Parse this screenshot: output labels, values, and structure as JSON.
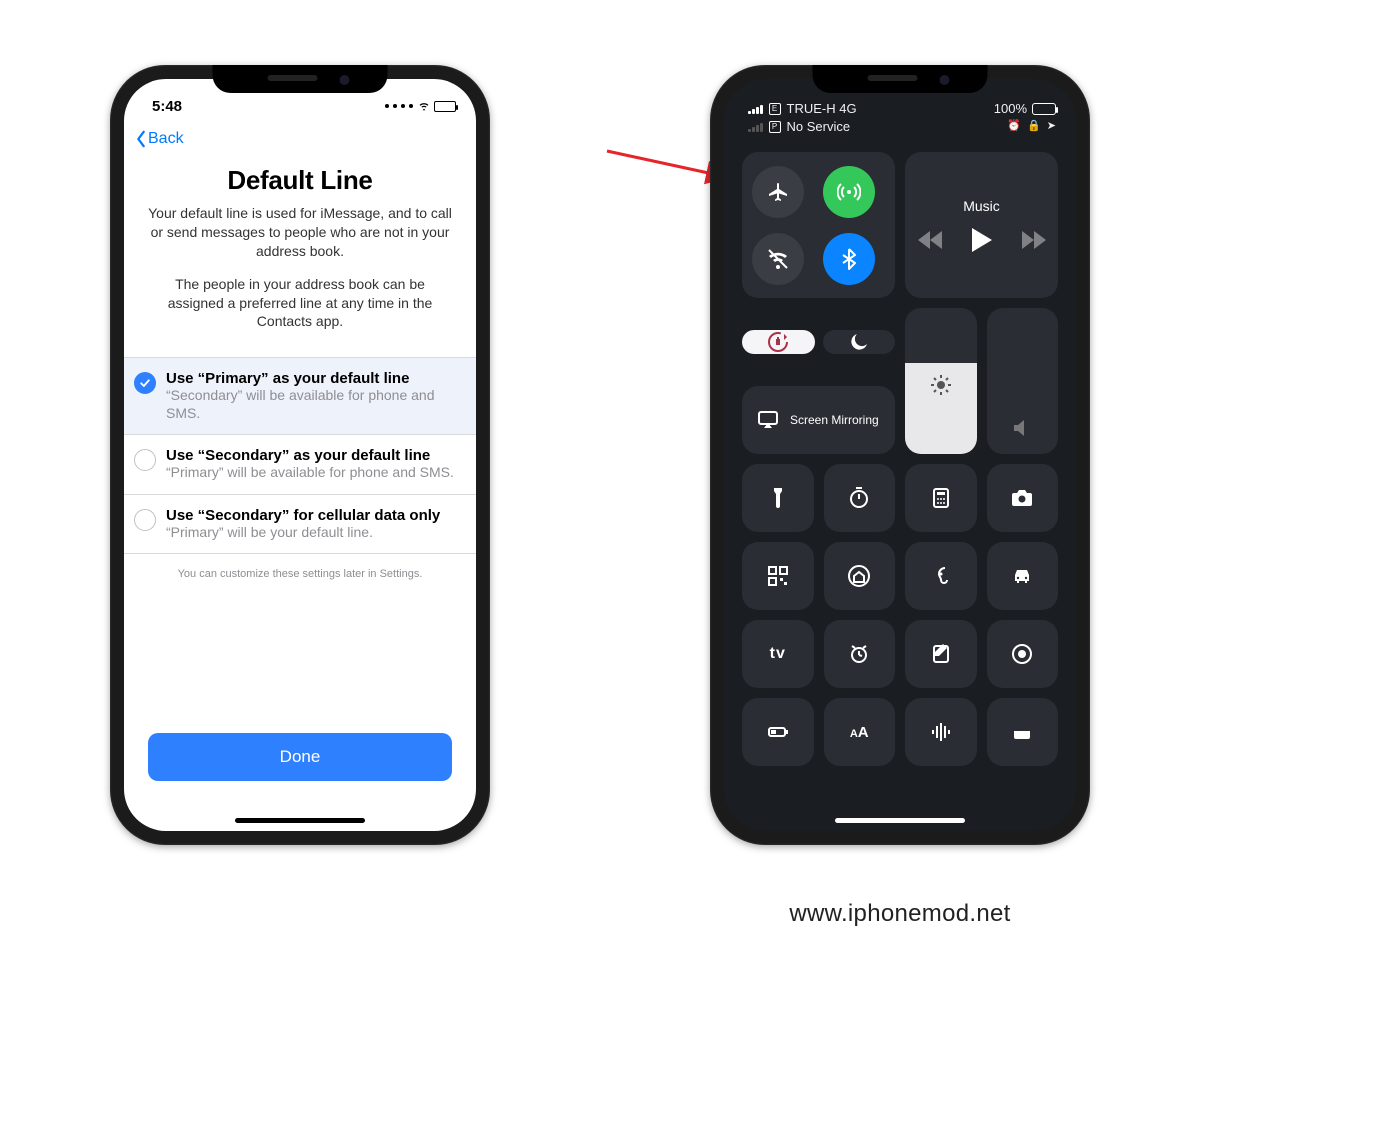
{
  "phone1": {
    "time": "5:48",
    "back_label": "Back",
    "title": "Default Line",
    "intro1": "Your default line is used for iMessage, and to call or send messages to people who are not in your address book.",
    "intro2": "The people in your address book can be assigned a preferred line at any time in the Contacts app.",
    "options": [
      {
        "title": "Use “Primary” as your default line",
        "sub": "“Secondary” will be available for phone and SMS.",
        "selected": true
      },
      {
        "title": "Use “Secondary” as your default line",
        "sub": "“Primary” will be available for phone and SMS.",
        "selected": false
      },
      {
        "title": "Use “Secondary” for cellular data only",
        "sub": "“Primary” will be your default line.",
        "selected": false
      }
    ],
    "hint": "You can customize these settings later in Settings.",
    "done_label": "Done"
  },
  "phone2": {
    "sim1": {
      "letter": "E",
      "carrier": "TRUE-H 4G",
      "bars": 4
    },
    "sim2": {
      "letter": "P",
      "carrier": "No Service",
      "bars": 0
    },
    "battery": "100%",
    "music_label": "Music",
    "mirror_label": "Screen Mirroring",
    "brightness_pct": 62,
    "volume_pct": 0,
    "tiles": {
      "airplane": "airplane-icon",
      "cellular": "cellular-icon",
      "wifi": "wifi-off-icon",
      "bluetooth": "bluetooth-icon",
      "orientation_lock": "rotation-lock-icon",
      "dnd": "moon-icon",
      "flashlight": "flashlight-icon",
      "timer": "timer-icon",
      "calculator": "calculator-icon",
      "camera": "camera-icon",
      "qr": "qr-icon",
      "home": "home-icon",
      "hearing": "ear-icon",
      "carplay": "car-icon",
      "appletv": "appletv-icon",
      "alarm": "alarm-icon",
      "notes": "notes-icon",
      "record": "record-icon",
      "lowpower": "battery-icon",
      "textsize": "textsize-icon",
      "voice": "waveform-icon",
      "wallet": "wallet-icon"
    }
  },
  "watermark": "www.iphonemod.net"
}
